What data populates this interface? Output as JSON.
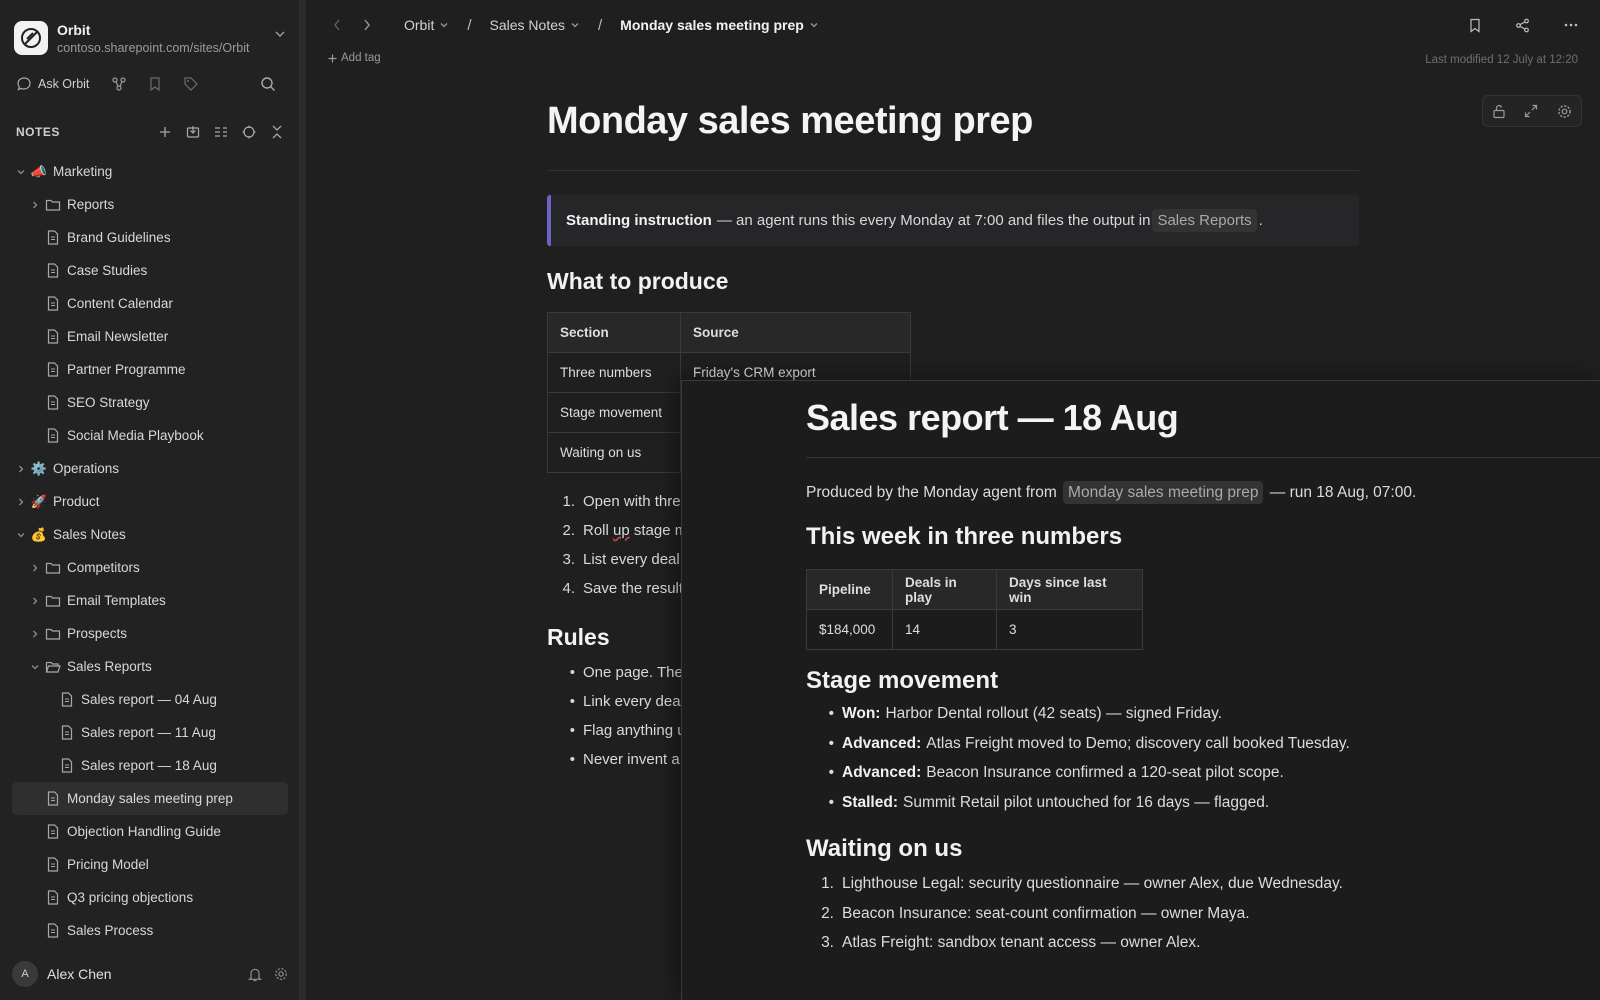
{
  "workspace": {
    "name": "Orbit",
    "url": "contoso.sharepoint.com/sites/Orbit"
  },
  "toolbar": {
    "ask_label": "Ask Orbit"
  },
  "notes_header": "NOTES",
  "tree": [
    {
      "label": "Marketing",
      "emoji": "📣",
      "depth": 0,
      "kind": "group",
      "open": true
    },
    {
      "label": "Reports",
      "depth": 1,
      "kind": "folder",
      "open": false
    },
    {
      "label": "Brand Guidelines",
      "depth": 1,
      "kind": "doc"
    },
    {
      "label": "Case Studies",
      "depth": 1,
      "kind": "doc"
    },
    {
      "label": "Content Calendar",
      "depth": 1,
      "kind": "doc"
    },
    {
      "label": "Email Newsletter",
      "depth": 1,
      "kind": "doc"
    },
    {
      "label": "Partner Programme",
      "depth": 1,
      "kind": "doc"
    },
    {
      "label": "SEO Strategy",
      "depth": 1,
      "kind": "doc"
    },
    {
      "label": "Social Media Playbook",
      "depth": 1,
      "kind": "doc"
    },
    {
      "label": "Operations",
      "emoji": "⚙️",
      "depth": 0,
      "kind": "group",
      "open": false
    },
    {
      "label": "Product",
      "emoji": "🚀",
      "depth": 0,
      "kind": "group",
      "open": false
    },
    {
      "label": "Sales Notes",
      "emoji": "💰",
      "depth": 0,
      "kind": "group",
      "open": true
    },
    {
      "label": "Competitors",
      "depth": 1,
      "kind": "folder",
      "open": false
    },
    {
      "label": "Email Templates",
      "depth": 1,
      "kind": "folder",
      "open": false
    },
    {
      "label": "Prospects",
      "depth": 1,
      "kind": "folder",
      "open": false
    },
    {
      "label": "Sales Reports",
      "depth": 1,
      "kind": "folder",
      "open": true
    },
    {
      "label": "Sales report — 04 Aug",
      "depth": 2,
      "kind": "doc"
    },
    {
      "label": "Sales report — 11 Aug",
      "depth": 2,
      "kind": "doc"
    },
    {
      "label": "Sales report — 18 Aug",
      "depth": 2,
      "kind": "doc"
    },
    {
      "label": "Monday sales meeting prep",
      "depth": 1,
      "kind": "doc",
      "selected": true
    },
    {
      "label": "Objection Handling Guide",
      "depth": 1,
      "kind": "doc"
    },
    {
      "label": "Pricing Model",
      "depth": 1,
      "kind": "doc"
    },
    {
      "label": "Q3 pricing objections",
      "depth": 1,
      "kind": "doc"
    },
    {
      "label": "Sales Process",
      "depth": 1,
      "kind": "doc"
    }
  ],
  "user": {
    "initial": "A",
    "name": "Alex Chen"
  },
  "breadcrumb": {
    "workspace": "Orbit",
    "folder": "Sales Notes",
    "page": "Monday sales meeting prep",
    "separator": "/"
  },
  "add_tag": "Add tag",
  "last_modified": "Last modified 12 July at 12:20",
  "doc": {
    "title": "Monday sales meeting prep",
    "callout": {
      "bold": "Standing instruction",
      "text": "— an agent runs this every Monday at 7:00 and files the output in",
      "chip": "Sales Reports",
      "end": "."
    },
    "h_produce": "What to produce",
    "table": {
      "headers": [
        "Section",
        "Source"
      ],
      "rows": [
        [
          "Three numbers",
          "Friday's CRM export"
        ],
        [
          "Stage movement",
          ""
        ],
        [
          "Waiting on us",
          ""
        ]
      ]
    },
    "steps": [
      {
        "n": "1.",
        "text": "Open with thre"
      },
      {
        "n": "2.",
        "pre": "Roll ",
        "sq": "up",
        "post": " stage m"
      },
      {
        "n": "3.",
        "text": "List every deal"
      },
      {
        "n": "4.",
        "text": "Save the result"
      }
    ],
    "h_rules": "Rules",
    "rules": [
      "One page. The",
      "Link every deal",
      "Flag anything u",
      "Never invent a"
    ]
  },
  "panel": {
    "title": "Sales report — 18 Aug",
    "meta": {
      "pre": "Produced by the Monday agent from",
      "chip": "Monday sales meeting prep",
      "post": "— run 18 Aug, 07:00."
    },
    "h_numbers": "This week in three numbers",
    "numbers": {
      "headers": [
        "Pipeline",
        "Deals in play",
        "Days since last win"
      ],
      "values": [
        "$184,000",
        "14",
        "3"
      ]
    },
    "h_stage": "Stage movement",
    "stage": [
      {
        "label": "Won:",
        "text": "Harbor Dental rollout (42 seats) — signed Friday."
      },
      {
        "label": "Advanced:",
        "text": "Atlas Freight moved to Demo; discovery call booked Tuesday."
      },
      {
        "label": "Advanced:",
        "text": "Beacon Insurance confirmed a 120-seat pilot scope."
      },
      {
        "label": "Stalled:",
        "text": "Summit Retail pilot untouched for 16 days — flagged."
      }
    ],
    "h_waiting": "Waiting on us",
    "waiting": [
      {
        "n": "1.",
        "text": "Lighthouse Legal: security questionnaire — owner Alex, due Wednesday."
      },
      {
        "n": "2.",
        "text": "Beacon Insurance: seat-count confirmation — owner Maya."
      },
      {
        "n": "3.",
        "text": "Atlas Freight: sandbox tenant access — owner Alex."
      }
    ]
  },
  "colors": {
    "accent": "#6b64c4",
    "background": "#1f1f1f",
    "sidebar": "#222222"
  }
}
